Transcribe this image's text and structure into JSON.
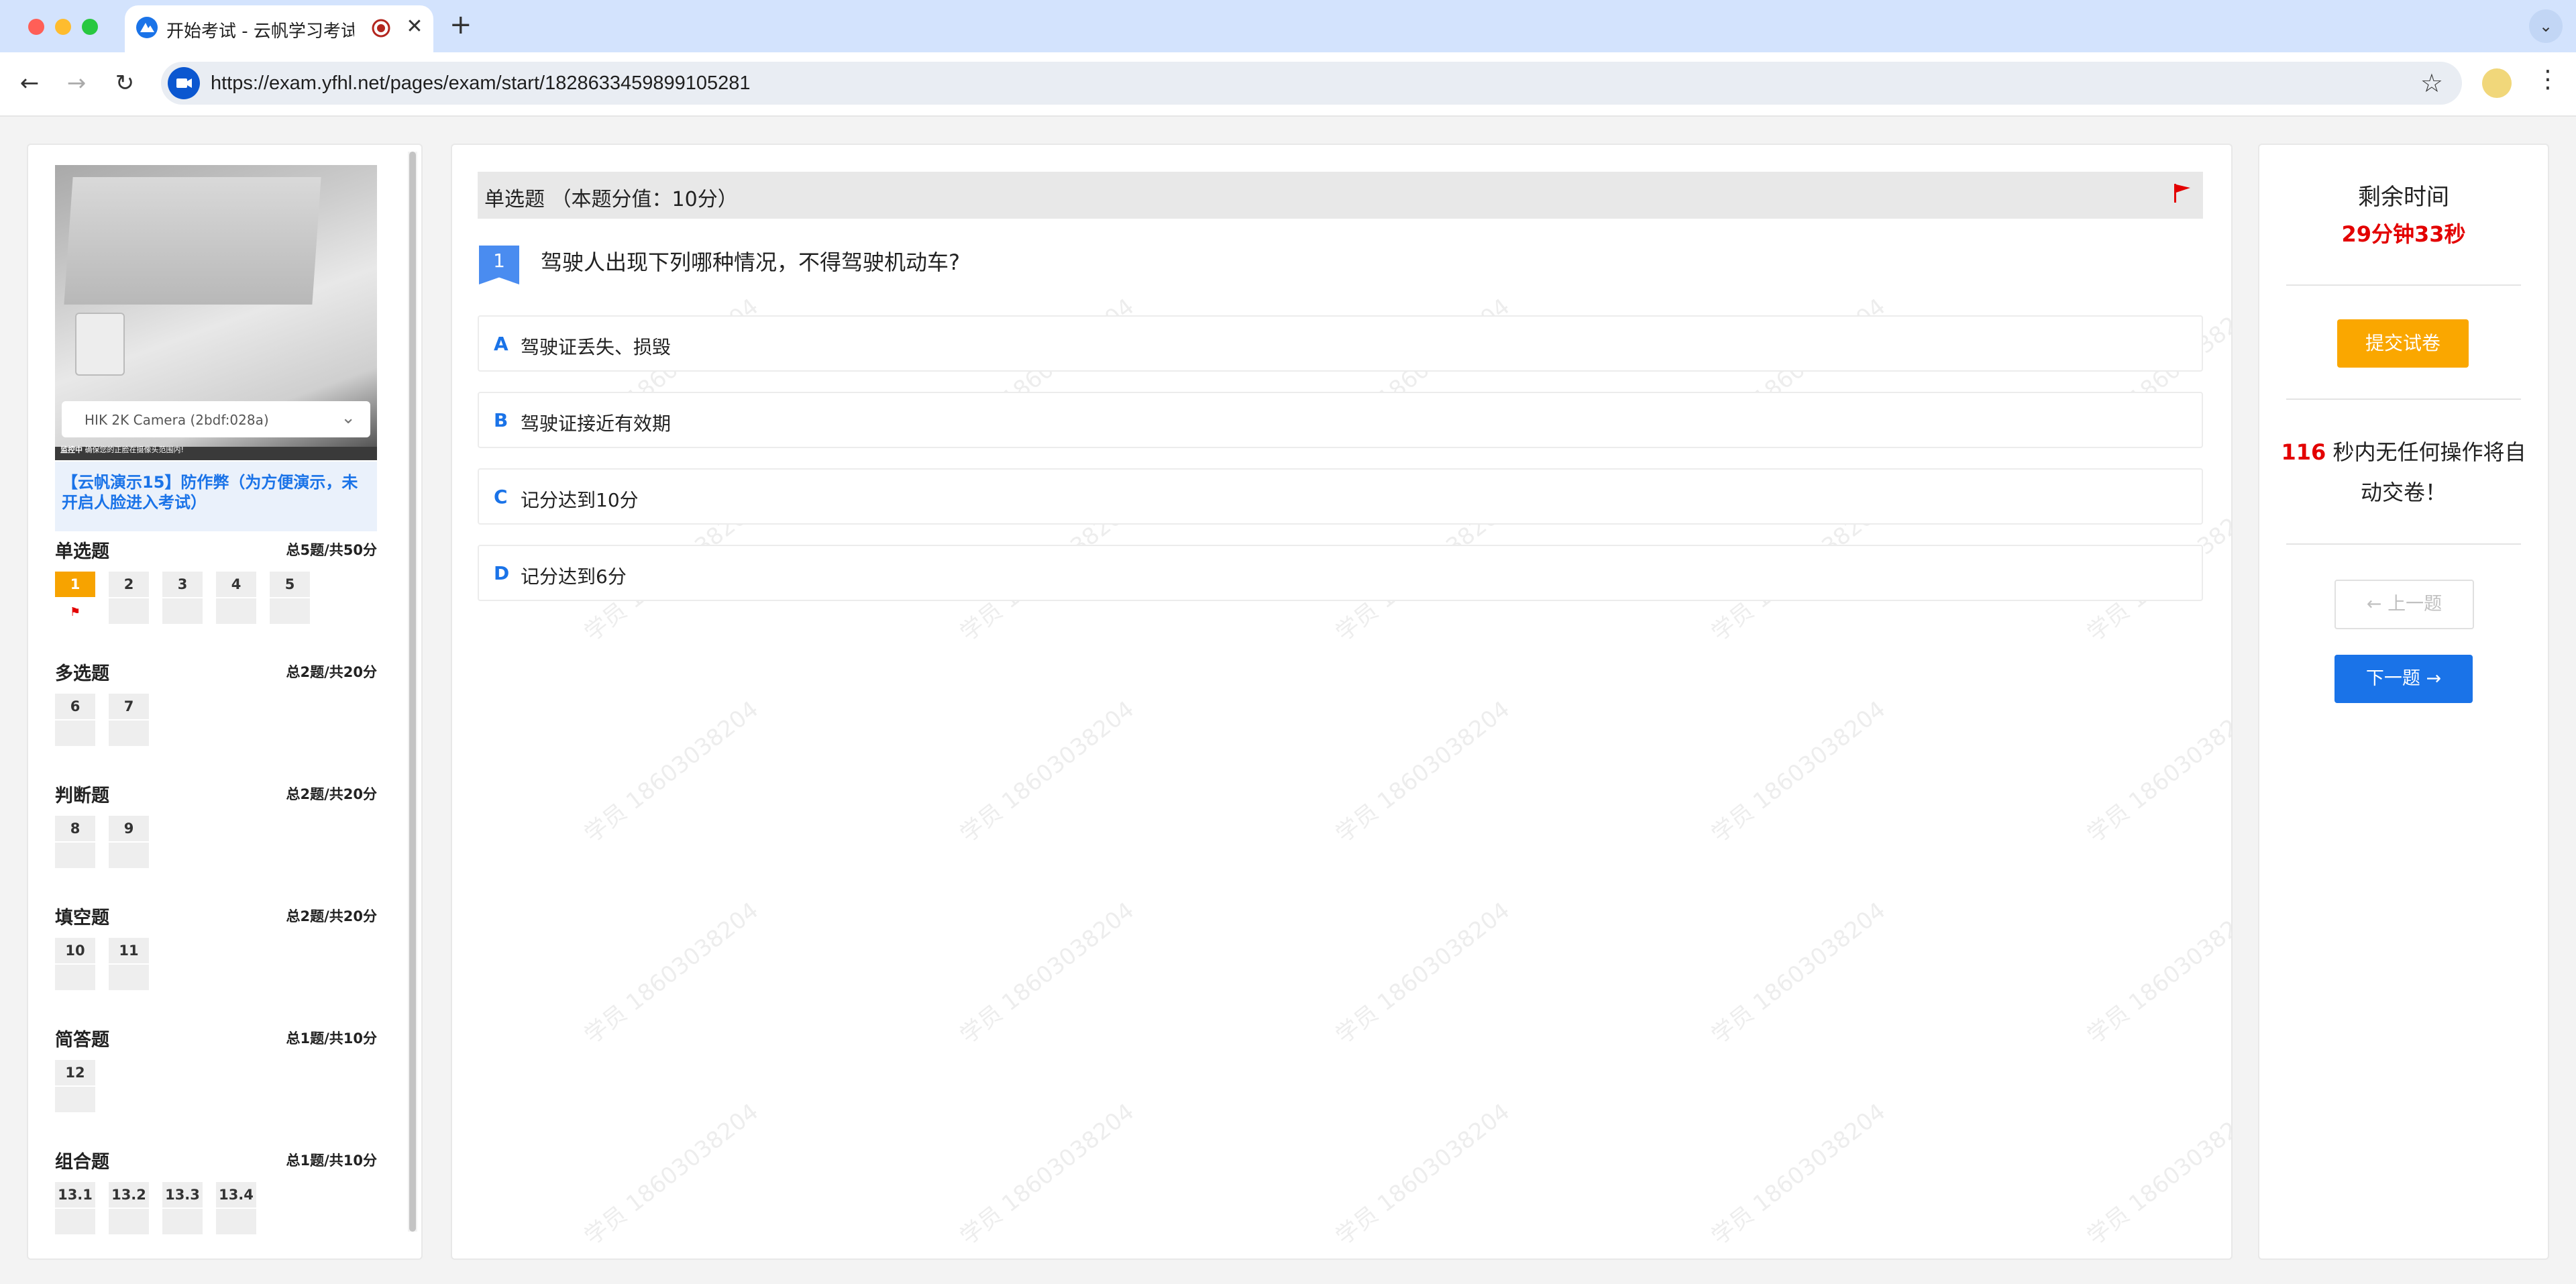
{
  "browser": {
    "tab_title": "开始考试 - 云帆学习考试系统",
    "url": "https://exam.yfhl.net/pages/exam/start/1828633459899105281"
  },
  "camera": {
    "device": "HIK 2K Camera (2bdf:028a)",
    "status_label": "监控中",
    "status_hint": "确保您的正脸在摄像头范围内!"
  },
  "exam": {
    "title": "【云帆演示15】防作弊（为方便演示，未开启人脸进入考试）"
  },
  "sections": [
    {
      "name": "单选题",
      "summary": "总5题/共50分",
      "questions": [
        "1",
        "2",
        "3",
        "4",
        "5"
      ]
    },
    {
      "name": "多选题",
      "summary": "总2题/共20分",
      "questions": [
        "6",
        "7"
      ]
    },
    {
      "name": "判断题",
      "summary": "总2题/共20分",
      "questions": [
        "8",
        "9"
      ]
    },
    {
      "name": "填空题",
      "summary": "总2题/共20分",
      "questions": [
        "10",
        "11"
      ]
    },
    {
      "name": "简答题",
      "summary": "总1题/共10分",
      "questions": [
        "12"
      ]
    },
    {
      "name": "组合题",
      "summary": "总1题/共10分",
      "questions": [
        "13.1",
        "13.2",
        "13.3",
        "13.4"
      ]
    }
  ],
  "current_question": {
    "type_label": "单选题 （本题分值：10分）",
    "number": "1",
    "text": "驾驶人出现下列哪种情况，不得驾驶机动车?",
    "options": [
      {
        "letter": "A",
        "text": "驾驶证丢失、损毁"
      },
      {
        "letter": "B",
        "text": "驾驶证接近有效期"
      },
      {
        "letter": "C",
        "text": "记分达到10分"
      },
      {
        "letter": "D",
        "text": "记分达到6分"
      }
    ]
  },
  "watermark": "学员 18603038204",
  "sidebar_right": {
    "time_label": "剩余时间",
    "time_value": "29分钟33秒",
    "submit_label": "提交试卷",
    "idle_seconds": "116",
    "idle_text": " 秒内无任何操作将自动交卷！",
    "prev_label": "← 上一题",
    "next_label": "下一题 →"
  },
  "colors": {
    "accent": "#1a73e8",
    "active_question": "#f7a300",
    "submit": "#faa700",
    "alert": "#e30000"
  }
}
